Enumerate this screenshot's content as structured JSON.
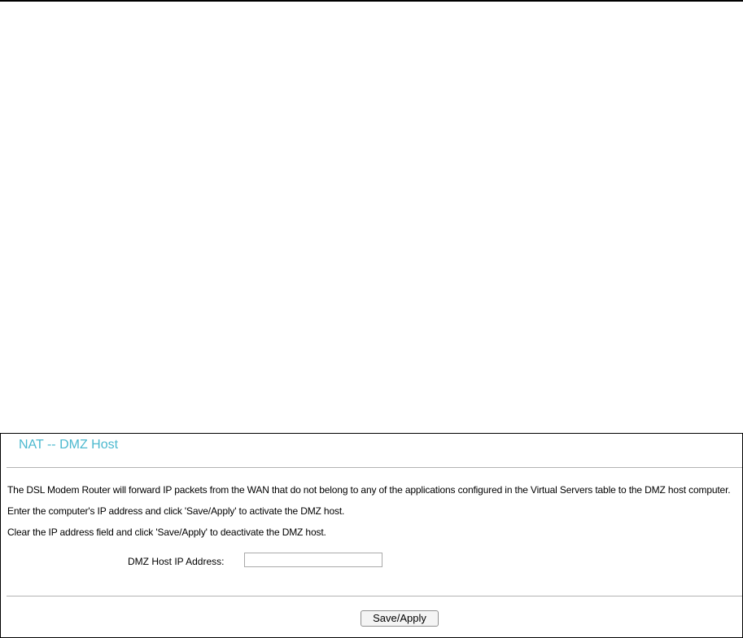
{
  "page": {
    "title": "NAT -- DMZ Host"
  },
  "description": {
    "line1": "The DSL Modem Router will forward IP packets from the WAN that do not belong to any of the applications configured in the Virtual Servers table to the DMZ host computer.",
    "line2": "Enter the computer's IP address and click 'Save/Apply' to activate the DMZ host.",
    "line3": "Clear the IP address field and click 'Save/Apply' to deactivate the DMZ host."
  },
  "form": {
    "dmz_label": "DMZ Host IP Address:",
    "dmz_value": "",
    "dmz_placeholder": ""
  },
  "actions": {
    "save_label": "Save/Apply"
  },
  "colors": {
    "title": "#4cb9cf",
    "border": "#000000",
    "divider": "#b3b3b3"
  }
}
